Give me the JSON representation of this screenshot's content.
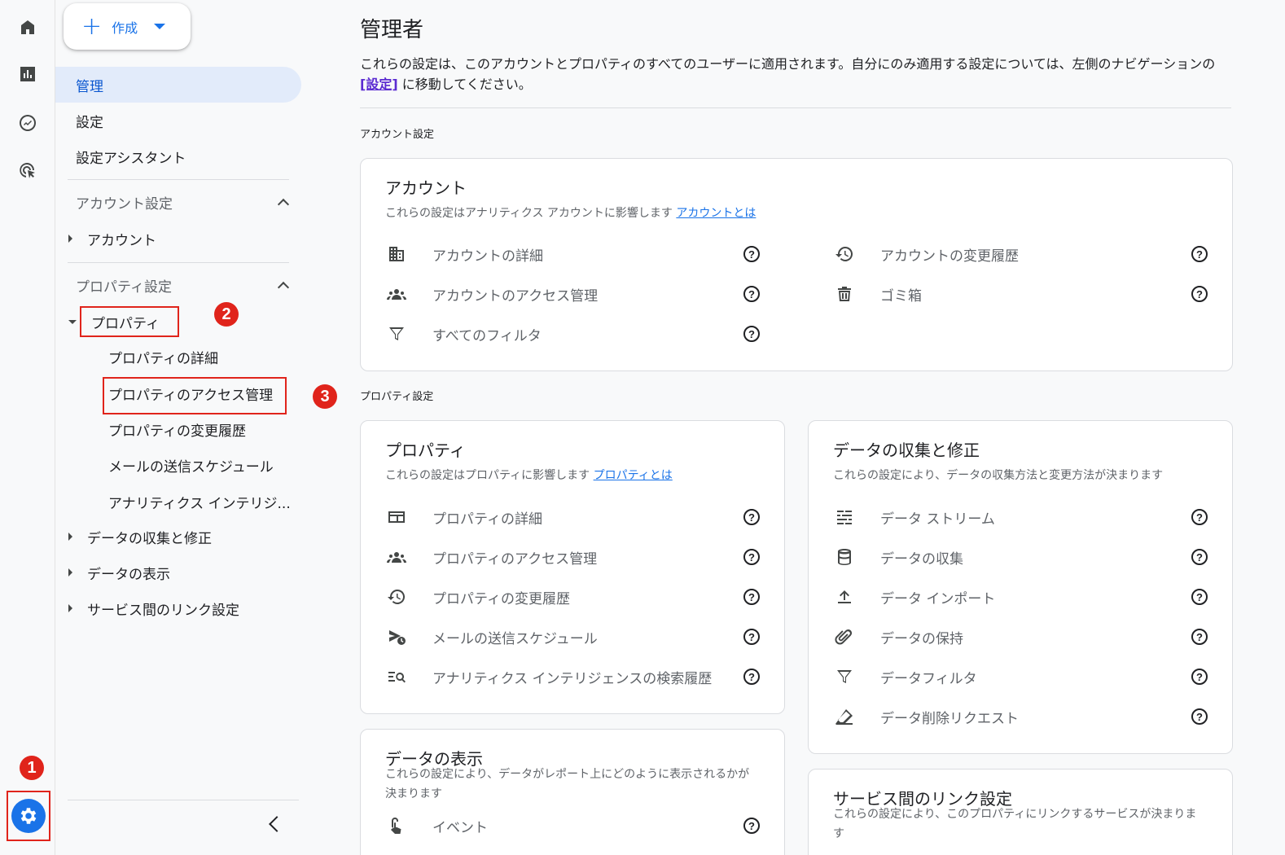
{
  "rail": {
    "icons": [
      "home-icon",
      "reports-icon",
      "explore-icon",
      "advertising-icon"
    ],
    "settings_icon": "gear-icon"
  },
  "markers": {
    "one": "1",
    "two": "2",
    "three": "3"
  },
  "nav": {
    "create_label": "作成",
    "admin": "管理",
    "settings": "設定",
    "setup_assistant": "設定アシスタント",
    "account_settings": "アカウント設定",
    "account": "アカウント",
    "property_settings": "プロパティ設定",
    "property": "プロパティ",
    "property_details": "プロパティの詳細",
    "property_access": "プロパティのアクセス管理",
    "property_history": "プロパティの変更履歴",
    "email_schedule": "メールの送信スケジュール",
    "analytics_intel": "アナリティクス インテリジ...",
    "data_collection": "データの収集と修正",
    "data_display": "データの表示",
    "product_links": "サービス間のリンク設定"
  },
  "main": {
    "title": "管理者",
    "desc_before": "これらの設定は、このアカウントとプロパティのすべてのユーザーに適用されます。自分にのみ適用する設定については、左側のナビゲーションの ",
    "desc_link": "[設定]",
    "desc_after": " に移動してください。",
    "account_section": "アカウント設定",
    "property_section": "プロパティ設定"
  },
  "account_card": {
    "title": "アカウント",
    "subtitle": "これらの設定はアナリティクス アカウントに影響します ",
    "link": "アカウントとは",
    "left": [
      {
        "label": "アカウントの詳細",
        "icon": "building-icon"
      },
      {
        "label": "アカウントのアクセス管理",
        "icon": "people-icon"
      },
      {
        "label": "すべてのフィルタ",
        "icon": "filter-icon"
      }
    ],
    "right": [
      {
        "label": "アカウントの変更履歴",
        "icon": "history-icon"
      },
      {
        "label": "ゴミ箱",
        "icon": "trash-icon"
      }
    ]
  },
  "property_card": {
    "title": "プロパティ",
    "subtitle": "これらの設定はプロパティに影響します ",
    "link": "プロパティとは",
    "items": [
      {
        "label": "プロパティの詳細",
        "icon": "property-details-icon"
      },
      {
        "label": "プロパティのアクセス管理",
        "icon": "people-icon"
      },
      {
        "label": "プロパティの変更履歴",
        "icon": "history-icon"
      },
      {
        "label": "メールの送信スケジュール",
        "icon": "scheduled-email-icon"
      },
      {
        "label": "アナリティクス インテリジェンスの検索履歴",
        "icon": "search-history-icon"
      }
    ]
  },
  "data_card": {
    "title": "データの収集と修正",
    "subtitle": "これらの設定により、データの収集方法と変更方法が決まります",
    "items": [
      {
        "label": "データ ストリーム",
        "icon": "stream-icon"
      },
      {
        "label": "データの収集",
        "icon": "database-icon"
      },
      {
        "label": "データ インポート",
        "icon": "upload-icon"
      },
      {
        "label": "データの保持",
        "icon": "retention-icon"
      },
      {
        "label": "データフィルタ",
        "icon": "filter-icon"
      },
      {
        "label": "データ削除リクエスト",
        "icon": "eraser-icon"
      }
    ]
  },
  "display_card": {
    "title": "データの表示",
    "subtitle": "これらの設定により、データがレポート上にどのように表示されるかが決まります",
    "items": [
      {
        "label": "イベント",
        "icon": "touch-icon"
      }
    ]
  },
  "links_card": {
    "title": "サービス間のリンク設定",
    "subtitle": "これらの設定により、このプロパティにリンクするサービスが決まります"
  },
  "help_glyph": "?"
}
